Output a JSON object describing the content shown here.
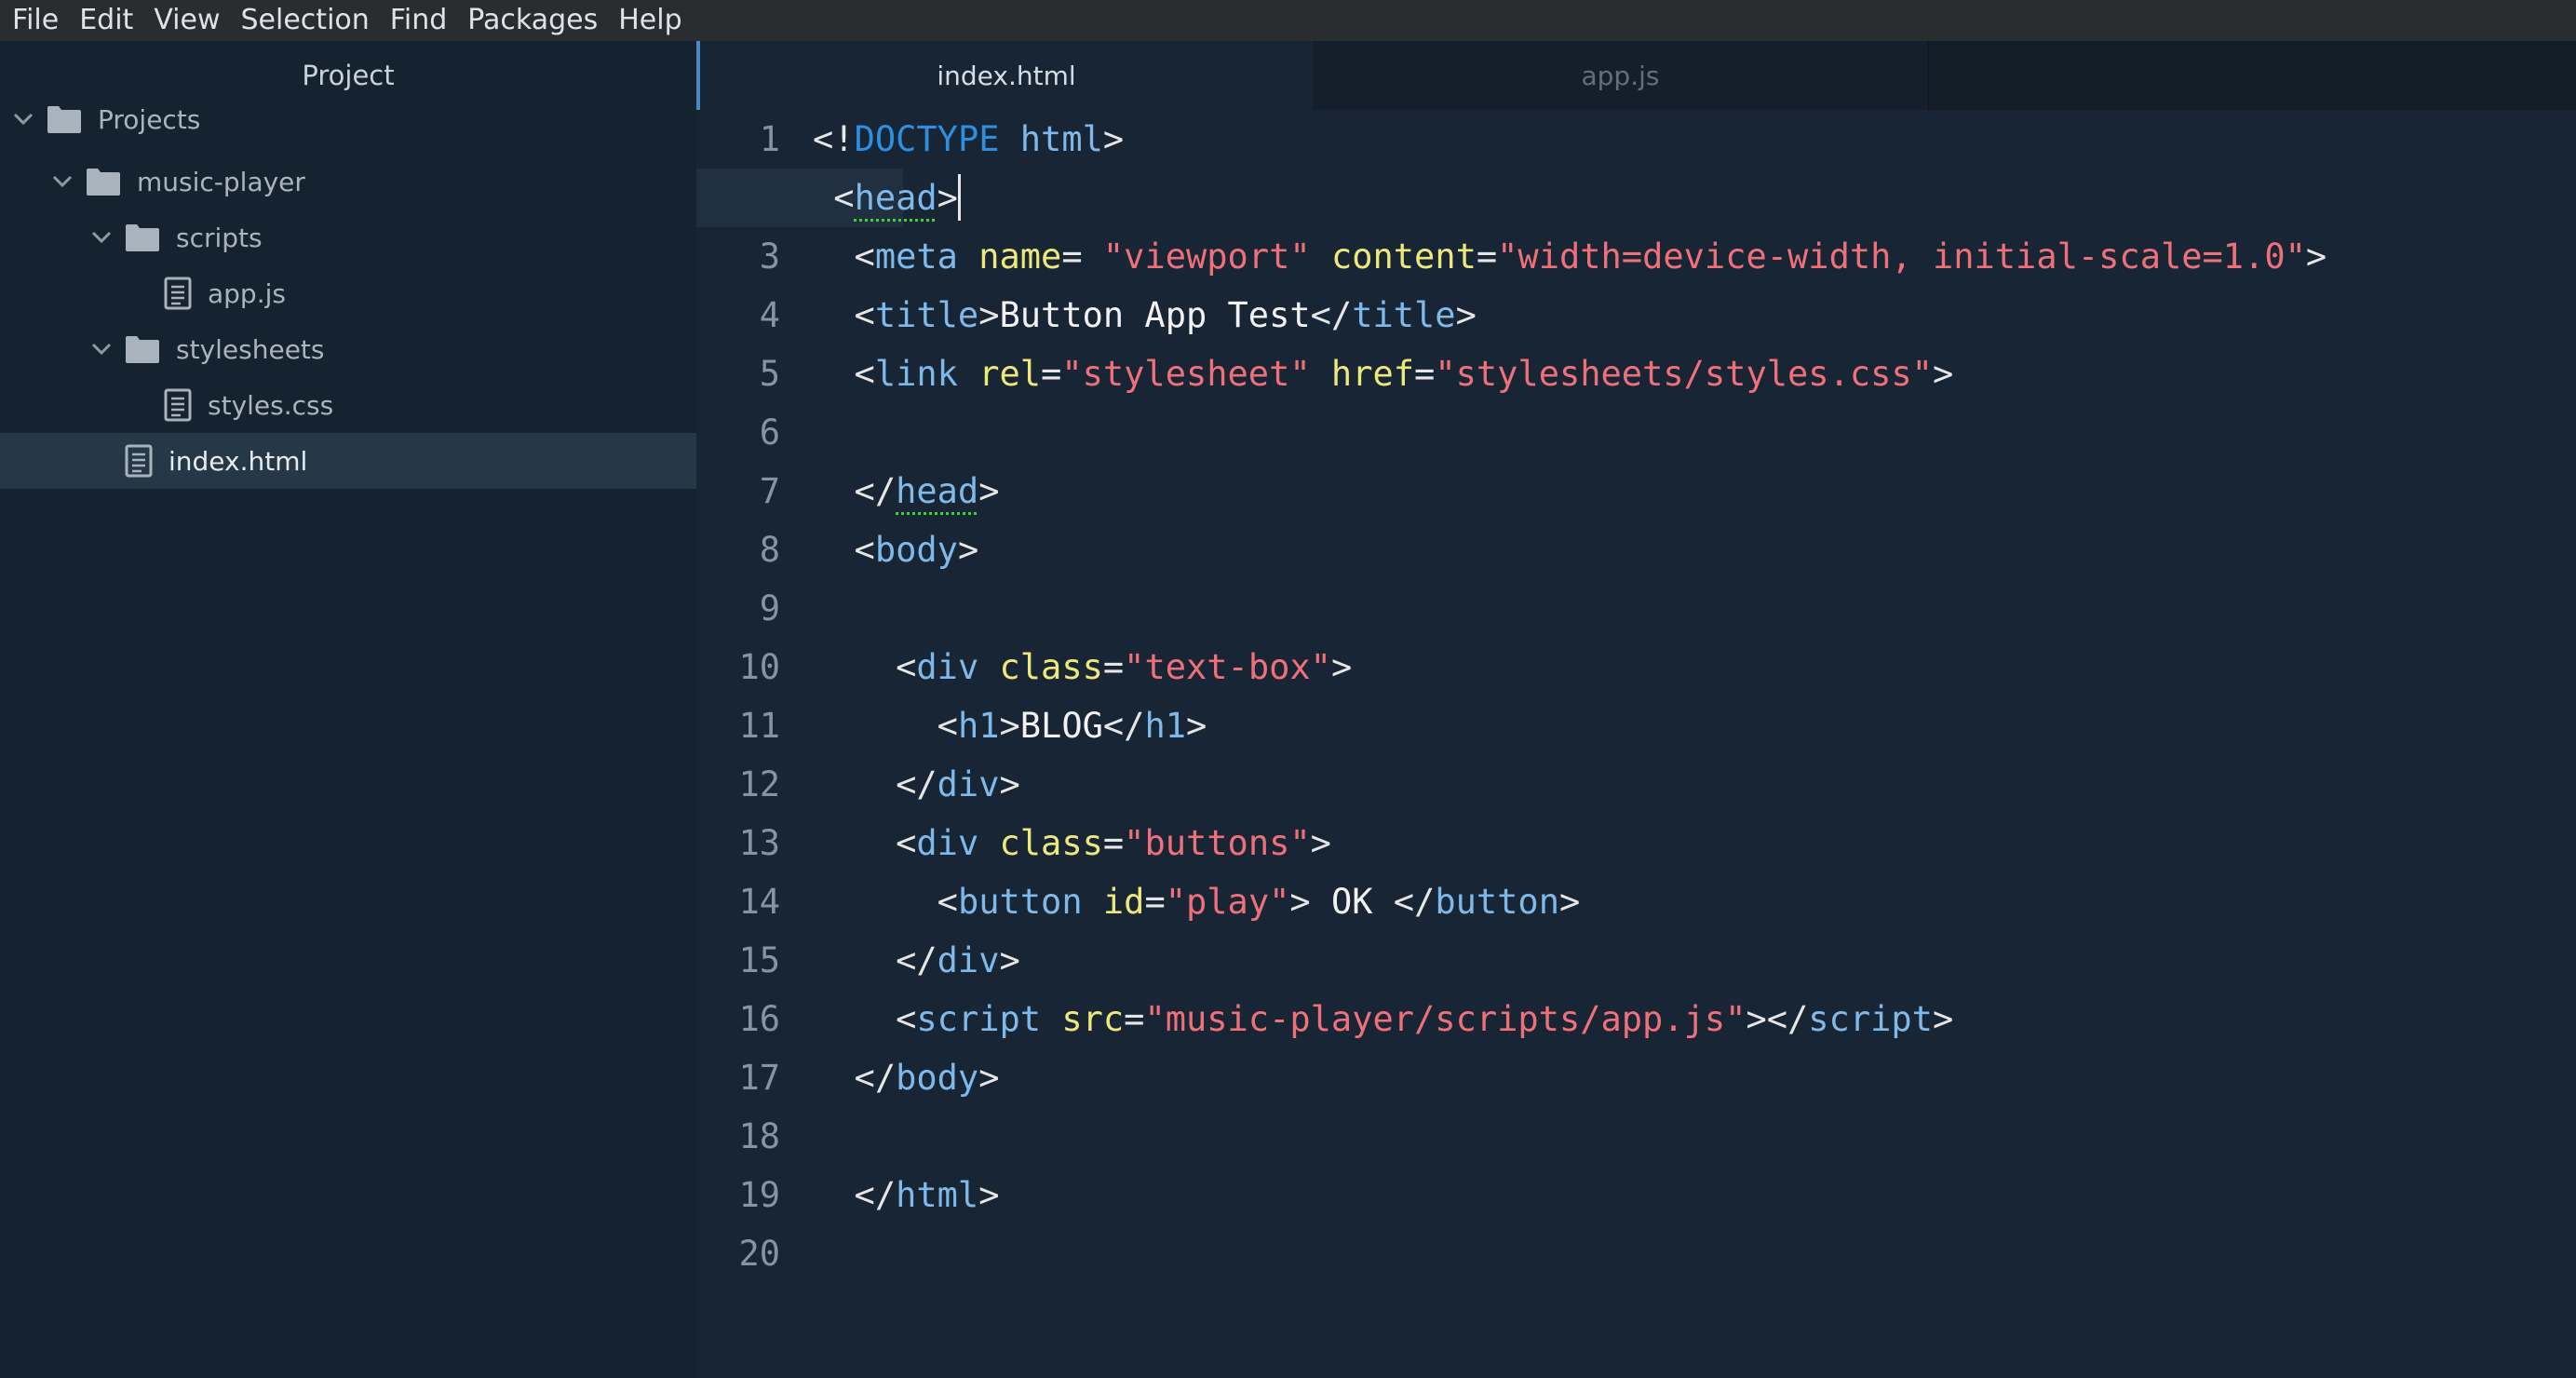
{
  "menubar": {
    "items": [
      "File",
      "Edit",
      "View",
      "Selection",
      "Find",
      "Packages",
      "Help"
    ]
  },
  "sidebar": {
    "title": "Project",
    "tree": [
      {
        "label": "Projects",
        "type": "folder",
        "expanded": true,
        "depth": 0
      },
      {
        "label": "music-player",
        "type": "folder",
        "expanded": true,
        "depth": 1
      },
      {
        "label": "scripts",
        "type": "folder",
        "expanded": true,
        "depth": 2
      },
      {
        "label": "app.js",
        "type": "file",
        "depth": 3
      },
      {
        "label": "stylesheets",
        "type": "folder",
        "expanded": true,
        "depth": 2
      },
      {
        "label": "styles.css",
        "type": "file",
        "depth": 3
      },
      {
        "label": "index.html",
        "type": "file",
        "depth": 2,
        "selected": true
      }
    ]
  },
  "tabs": [
    {
      "label": "index.html",
      "active": true
    },
    {
      "label": "app.js",
      "active": false
    }
  ],
  "editor": {
    "current_line": 2,
    "lines": [
      [
        [
          "pn",
          "<!"
        ],
        [
          "dt",
          "DOCTYPE"
        ],
        [
          "pn",
          " "
        ],
        [
          "tg",
          "html"
        ],
        [
          "pn",
          ">"
        ]
      ],
      [
        [
          "pn",
          " <"
        ],
        [
          "tg",
          "head",
          "ul"
        ],
        [
          "pn",
          ">"
        ]
      ],
      [
        [
          "pn",
          "  <"
        ],
        [
          "tg",
          "meta"
        ],
        [
          "pn",
          " "
        ],
        [
          "at",
          "name"
        ],
        [
          "pn",
          "= "
        ],
        [
          "st",
          "\"viewport\""
        ],
        [
          "pn",
          " "
        ],
        [
          "at",
          "content"
        ],
        [
          "pn",
          "="
        ],
        [
          "st",
          "\"width=device-width, initial-scale=1.0\""
        ],
        [
          "pn",
          ">"
        ]
      ],
      [
        [
          "pn",
          "  <"
        ],
        [
          "tg",
          "title"
        ],
        [
          "pn",
          ">"
        ],
        [
          "tx",
          "Button App Test"
        ],
        [
          "pn",
          "</"
        ],
        [
          "tg",
          "title"
        ],
        [
          "pn",
          ">"
        ]
      ],
      [
        [
          "pn",
          "  <"
        ],
        [
          "tg",
          "link"
        ],
        [
          "pn",
          " "
        ],
        [
          "at",
          "rel"
        ],
        [
          "pn",
          "="
        ],
        [
          "st",
          "\"stylesheet\""
        ],
        [
          "pn",
          " "
        ],
        [
          "at",
          "href"
        ],
        [
          "pn",
          "="
        ],
        [
          "st",
          "\"stylesheets/styles.css\""
        ],
        [
          "pn",
          ">"
        ]
      ],
      [],
      [
        [
          "pn",
          "  </"
        ],
        [
          "tg",
          "head",
          "ul"
        ],
        [
          "pn",
          ">"
        ]
      ],
      [
        [
          "pn",
          "  <"
        ],
        [
          "tg",
          "body"
        ],
        [
          "pn",
          ">"
        ]
      ],
      [],
      [
        [
          "pn",
          "    <"
        ],
        [
          "tg",
          "div"
        ],
        [
          "pn",
          " "
        ],
        [
          "at",
          "class"
        ],
        [
          "pn",
          "="
        ],
        [
          "st",
          "\"text-box\""
        ],
        [
          "pn",
          ">"
        ]
      ],
      [
        [
          "pn",
          "      <"
        ],
        [
          "tg",
          "h1"
        ],
        [
          "pn",
          ">"
        ],
        [
          "tx",
          "BLOG"
        ],
        [
          "pn",
          "</"
        ],
        [
          "tg",
          "h1"
        ],
        [
          "pn",
          ">"
        ]
      ],
      [
        [
          "pn",
          "    </"
        ],
        [
          "tg",
          "div"
        ],
        [
          "pn",
          ">"
        ]
      ],
      [
        [
          "pn",
          "    <"
        ],
        [
          "tg",
          "div"
        ],
        [
          "pn",
          " "
        ],
        [
          "at",
          "class"
        ],
        [
          "pn",
          "="
        ],
        [
          "st",
          "\"buttons\""
        ],
        [
          "pn",
          ">"
        ]
      ],
      [
        [
          "pn",
          "      <"
        ],
        [
          "tg",
          "button"
        ],
        [
          "pn",
          " "
        ],
        [
          "at",
          "id"
        ],
        [
          "pn",
          "="
        ],
        [
          "st",
          "\"play\""
        ],
        [
          "pn",
          "> "
        ],
        [
          "tx",
          "OK"
        ],
        [
          "pn",
          " </"
        ],
        [
          "tg",
          "button"
        ],
        [
          "pn",
          ">"
        ]
      ],
      [
        [
          "pn",
          "    </"
        ],
        [
          "tg",
          "div"
        ],
        [
          "pn",
          ">"
        ]
      ],
      [
        [
          "pn",
          "    <"
        ],
        [
          "tg",
          "script"
        ],
        [
          "pn",
          " "
        ],
        [
          "at",
          "src"
        ],
        [
          "pn",
          "="
        ],
        [
          "st",
          "\"music-player/scripts/app.js\""
        ],
        [
          "pn",
          "></"
        ],
        [
          "tg",
          "script"
        ],
        [
          "pn",
          ">"
        ]
      ],
      [
        [
          "pn",
          "  </"
        ],
        [
          "tg",
          "body"
        ],
        [
          "pn",
          ">"
        ]
      ],
      [],
      [
        [
          "pn",
          "  </"
        ],
        [
          "tg",
          "html"
        ],
        [
          "pn",
          ">"
        ]
      ],
      []
    ]
  }
}
